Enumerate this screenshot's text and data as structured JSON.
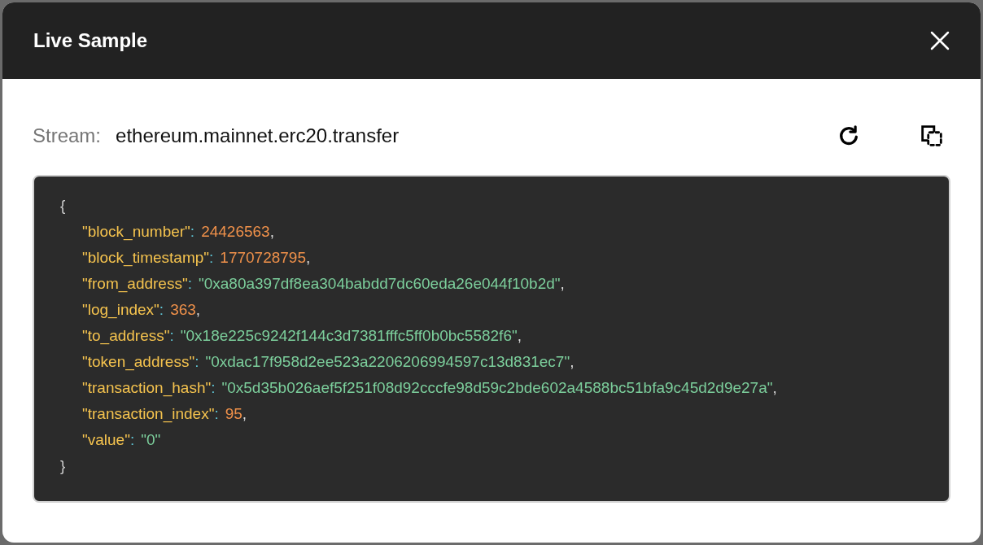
{
  "dialog": {
    "title": "Live Sample"
  },
  "stream": {
    "label": "Stream:",
    "value": "ethereum.mainnet.erc20.transfer"
  },
  "sample": {
    "open_brace": "{",
    "close_brace": "}",
    "lines": [
      {
        "key": "\"block_number\"",
        "separator": ":",
        "value": "24426563",
        "kind": "number",
        "trailing": ","
      },
      {
        "key": "\"block_timestamp\"",
        "separator": ":",
        "value": "1770728795",
        "kind": "number",
        "trailing": ","
      },
      {
        "key": "\"from_address\"",
        "separator": ":",
        "value": "\"0xa80a397df8ea304babdd7dc60eda26e044f10b2d\"",
        "kind": "string",
        "trailing": ","
      },
      {
        "key": "\"log_index\"",
        "separator": ":",
        "value": "363",
        "kind": "number",
        "trailing": ","
      },
      {
        "key": "\"to_address\"",
        "separator": ":",
        "value": "\"0x18e225c9242f144c3d7381fffc5ff0b0bc5582f6\"",
        "kind": "string",
        "trailing": ","
      },
      {
        "key": "\"token_address\"",
        "separator": ":",
        "value": "\"0xdac17f958d2ee523a2206206994597c13d831ec7\"",
        "kind": "string",
        "trailing": ","
      },
      {
        "key": "\"transaction_hash\"",
        "separator": ":",
        "value": "\"0x5d35b026aef5f251f08d92cccfe98d59c2bde602a4588bc51bfa9c45d2d9e27a\"",
        "kind": "string",
        "trailing": ","
      },
      {
        "key": "\"transaction_index\"",
        "separator": ":",
        "value": "95",
        "kind": "number",
        "trailing": ","
      },
      {
        "key": "\"value\"",
        "separator": ":",
        "value": "\"0\"",
        "kind": "string"
      }
    ]
  }
}
